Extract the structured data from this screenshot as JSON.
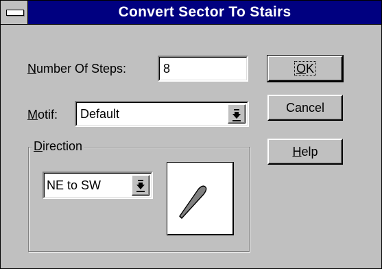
{
  "window": {
    "title": "Convert Sector To Stairs"
  },
  "steps": {
    "label_prefix": "",
    "label_mnemonic": "N",
    "label_rest": "umber Of Steps:",
    "value": "8"
  },
  "motif": {
    "label_mnemonic": "M",
    "label_rest": "otif:",
    "value": "Default"
  },
  "direction": {
    "label_mnemonic": "D",
    "label_rest": "irection",
    "value": "NE to SW",
    "preview_icon": "stair-direction-arrow-icon"
  },
  "buttons": {
    "ok": {
      "mnemonic": "O",
      "rest": "K"
    },
    "cancel": "Cancel",
    "help": {
      "mnemonic": "H",
      "rest": "elp"
    }
  },
  "colors": {
    "titlebar": "#000080",
    "face": "#c0c0c0"
  }
}
